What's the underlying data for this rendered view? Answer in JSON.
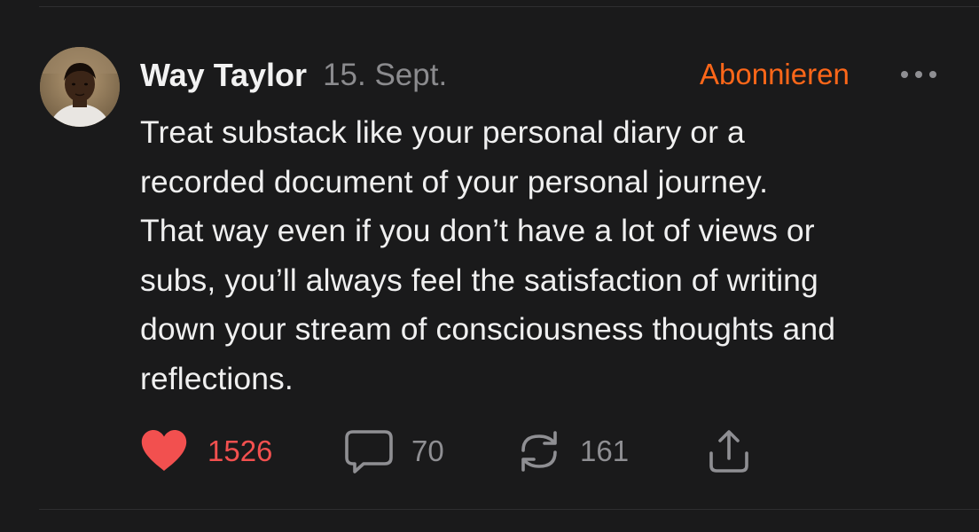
{
  "post": {
    "author": "Way Taylor",
    "date": "15. Sept.",
    "subscribe_label": "Abonnieren",
    "body_lines": [
      "Treat substack like your personal diary or a",
      "recorded document of your personal journey.",
      "That way even if you don’t have a lot of views or",
      "subs, you’ll always feel the satisfaction of writing",
      "down your stream of consciousness thoughts and",
      "reflections."
    ]
  },
  "actions": {
    "likes": "1526",
    "comments": "70",
    "restacks": "161"
  },
  "colors": {
    "accent": "#ff6719",
    "like": "#f2504f",
    "muted": "#8f8f93",
    "background": "#1a1a1b",
    "text": "#f0f0f0"
  },
  "icons": {
    "more": "ellipsis-icon",
    "like": "heart-icon",
    "comment": "comment-bubble-icon",
    "restack": "restack-icon",
    "share": "share-icon"
  }
}
